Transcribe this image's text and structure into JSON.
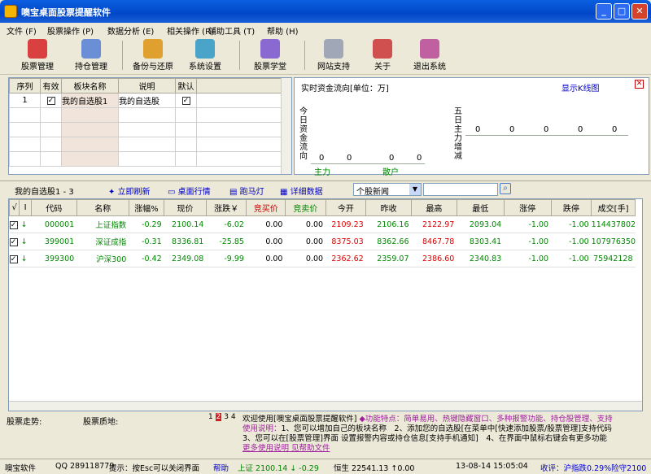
{
  "window": {
    "title": "噢宝桌面股票提醒软件"
  },
  "menu": [
    "文件 (F)",
    "股票操作 (P)",
    "数据分析 (E)",
    "相关操作 (R)",
    "辅助工具 (T)",
    "帮助 (H)"
  ],
  "toolbar": [
    "股票管理",
    "持仓管理",
    "备份与还原",
    "系统设置",
    "股票学堂",
    "网站支持",
    "关于",
    "退出系统"
  ],
  "blocks": {
    "headers": [
      "序列",
      "有效",
      "板块名称",
      "说明",
      "默认"
    ],
    "row": {
      "index": "1",
      "name": "我的自选股1",
      "desc": "我的自选股"
    }
  },
  "flow": {
    "title": "实时资金流向[单位：万]",
    "toggle": "显示K线图",
    "today_label": "今日资金流向",
    "five_label": "五日主力增减",
    "today_values": [
      "0",
      "0",
      "0",
      "0"
    ],
    "five_values": [
      "0",
      "0",
      "0",
      "0",
      "0"
    ],
    "legend_main": "主力",
    "legend_retail": "散户"
  },
  "sub": {
    "group": "我的自选股1 - 3",
    "refresh": "立即刷新",
    "desktop": "桌面行情",
    "marquee": "跑马灯",
    "detail": "详细数据",
    "news": "个股新闻",
    "search_value": ""
  },
  "table": {
    "headers": [
      "√",
      "I",
      "代码",
      "名称",
      "涨幅%",
      "现价",
      "涨跌￥",
      "竞买价",
      "竞卖价",
      "今开",
      "昨收",
      "最高",
      "最低",
      "涨停",
      "跌停",
      "成交[手]"
    ],
    "rows": [
      [
        "000001",
        "上证指数",
        "-0.29",
        "2100.14",
        "-6.02",
        "0.00",
        "0.00",
        "2109.23",
        "2106.16",
        "2122.97",
        "2093.04",
        "-1.00",
        "-1.00",
        "114437802"
      ],
      [
        "399001",
        "深证成指",
        "-0.31",
        "8336.81",
        "-25.85",
        "0.00",
        "0.00",
        "8375.03",
        "8362.66",
        "8467.78",
        "8303.41",
        "-1.00",
        "-1.00",
        "107976350"
      ],
      [
        "399300",
        "沪深300",
        "-0.42",
        "2349.08",
        "-9.99",
        "0.00",
        "0.00",
        "2362.62",
        "2359.07",
        "2386.60",
        "2340.83",
        "-1.00",
        "-1.00",
        "75942128"
      ]
    ]
  },
  "bottom": {
    "trend": "股票走势:",
    "quality": "股票质地:",
    "pages": [
      "1",
      "2",
      "3",
      "4"
    ],
    "welcome": "欢迎使用[噢宝桌面股票提醒软件]",
    "feature": "◆功能特点：简单易用、热键隐藏窗口、多种报警功能、持仓股管理、支持",
    "usage_label": "使用说明：",
    "usage1": "1、您可以增加自己的板块名称　2、添加您的自选股[在菜单中[快速添加股票/股票管理]支持代码",
    "usage2": "3、您可以在[股票管理]界面 设置报警内容或持仓信息[支持手机通知]　4、在界面中鼠标右键会有更多功能",
    "more": "更多使用说明 见帮助文件"
  },
  "status": {
    "company": "噢宝软件",
    "qq": "QQ 289118779",
    "hint": "提示：按Esc可以关闭界面",
    "help": "帮助",
    "sh": "上证 2100.14 ↓ -0.29",
    "hs": "恒生 22541.13 ↑0.00",
    "time": "13-08-14 15:05:04",
    "closing": "收评：沪指跌0.29%险守2100"
  }
}
